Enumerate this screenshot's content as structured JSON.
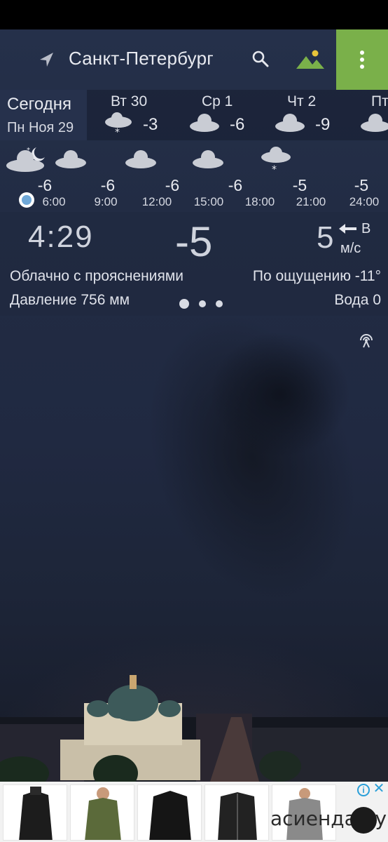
{
  "header": {
    "city": "Санкт-Петербург",
    "icons": [
      "location-arrow-icon",
      "search-icon",
      "landscape-icon",
      "more-vert-icon"
    ],
    "accent": "#7ab04a"
  },
  "days": {
    "today": {
      "label": "Сегодня",
      "date": "Пн Ноя 29"
    },
    "items": [
      {
        "name": "Вт 30",
        "temp": "-3",
        "icon": "snow-cloud-icon"
      },
      {
        "name": "Ср 1",
        "temp": "-6",
        "icon": "cloud-icon"
      },
      {
        "name": "Чт 2",
        "temp": "-9",
        "icon": "cloud-icon"
      },
      {
        "name": "Пт",
        "temp": "",
        "icon": "cloud-icon"
      }
    ]
  },
  "hourly": [
    {
      "temp": "-6",
      "time": "6:00",
      "icon": "night-cloud-icon"
    },
    {
      "temp": "-6",
      "time": "9:00",
      "icon": "cloud-icon"
    },
    {
      "temp": "-6",
      "time": "12:00",
      "icon": "cloud-icon"
    },
    {
      "temp": "-6",
      "time": "15:00",
      "icon": "cloud-icon"
    },
    {
      "temp": "-5",
      "time": "18:00",
      "icon": "snow-cloud-icon"
    },
    {
      "temp": "-5",
      "time": "21:00",
      "icon": "none"
    },
    {
      "temp": "-5",
      "time": "24:00",
      "icon": "none"
    }
  ],
  "current": {
    "time": "4:29",
    "temp": "-5",
    "wind_speed": "5",
    "wind_dir": "В",
    "wind_unit": "м/с",
    "condition": "Облачно с прояснениями",
    "feels_like": "По ощущению -11°",
    "pressure": "Давление 756 мм",
    "water": "Вода 0"
  },
  "ad": {
    "brand": "асиенда.ру",
    "info": "i",
    "close": "✕"
  }
}
